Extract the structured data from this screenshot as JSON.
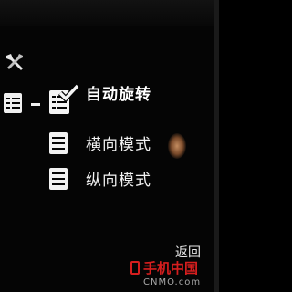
{
  "menu": {
    "items": [
      {
        "label": "自动旋转",
        "selected": true
      },
      {
        "label": "横向模式",
        "selected": false
      },
      {
        "label": "纵向模式",
        "selected": false
      }
    ]
  },
  "softkeys": {
    "back_label": "返回"
  },
  "watermark": {
    "brand": "手机中国",
    "domain": "CNMO.com"
  },
  "icons": {
    "settings": "tools-icon",
    "tree": "list-tree-icon",
    "checked": "check-list-icon",
    "landscape": "list-icon",
    "portrait": "list-icon"
  },
  "colors": {
    "background": "#050505",
    "text": "#f2f2f2",
    "watermark_red": "#d51e1e"
  }
}
